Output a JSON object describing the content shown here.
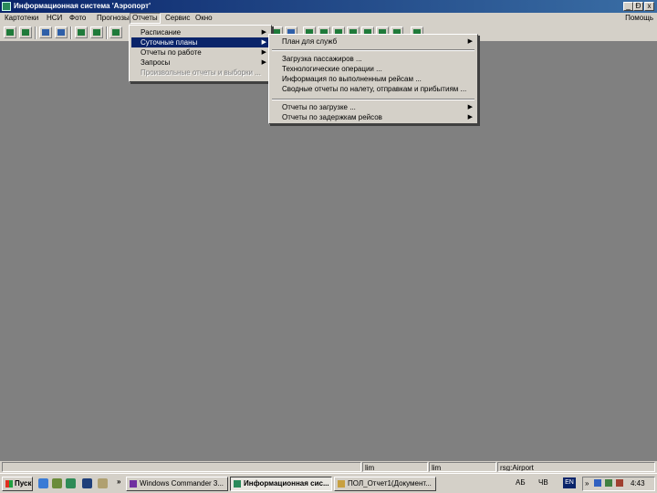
{
  "window": {
    "title": "Информационная система 'Аэропорт'"
  },
  "controls": {
    "minimize": "_",
    "restore": "Ɖ",
    "close": "x"
  },
  "menubar": {
    "items": [
      "Картотеки",
      "НСИ",
      "Фото",
      "Прогнозы",
      "Отчеты",
      "Сервис",
      "Окно"
    ],
    "right": "Помощь"
  },
  "reports_menu": {
    "items": [
      "Расписание",
      "Суточные планы",
      "Отчеты по работе",
      "Запросы",
      "Произвольные отчеты и выборки ..."
    ]
  },
  "daily_plans_submenu": {
    "items": [
      "План для служб",
      "Загрузка пассажиров ...",
      "Технологические операции ...",
      "Информация по выполненным рейсам ...",
      "Сводные отчеты по налету, отправкам и прибытиям ...",
      "Отчеты по загрузке ...",
      "Отчеты по задержкам рейсов"
    ]
  },
  "statusbar": {
    "cells": [
      "lim",
      "lim",
      "rsg:Airport"
    ]
  },
  "taskbar": {
    "start": "Пуск",
    "overflow": "»",
    "tasks": [
      "Windows Commander 3...",
      "Информационная сис...",
      "ПОЛ_Отчет1(Документ..."
    ],
    "tray": {
      "lang_kb": "АБ",
      "ms": "ЧВ",
      "lang": "EN",
      "clock": "4:43"
    }
  },
  "colors": {
    "selection": "#0a246a",
    "face": "#d4d0c8",
    "desktop": "#808080"
  }
}
